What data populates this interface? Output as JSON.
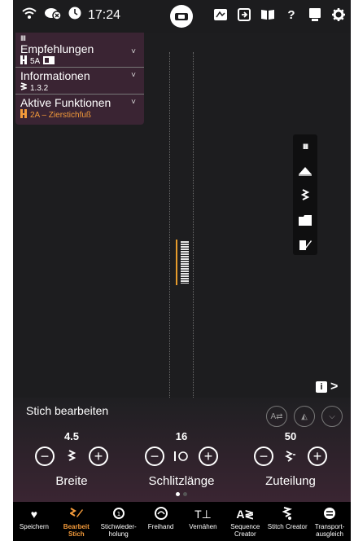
{
  "status": {
    "time": "17:24",
    "icons_left": [
      "wifi-icon",
      "cloud-off-icon",
      "clock-icon"
    ],
    "icons_right": [
      "embroidery-icon",
      "exit-icon",
      "book-icon",
      "help-icon",
      "window-icon",
      "gear-icon"
    ]
  },
  "info_panel": {
    "bars": "IIII",
    "recommendations": {
      "title": "Empfehlungen",
      "value": "5A"
    },
    "information": {
      "title": "Informationen",
      "value": "1.3.2"
    },
    "active_functions": {
      "title": "Aktive Funktionen",
      "value": "2A – Zierstichfuß"
    }
  },
  "right_toolbar": [
    "bars-icon",
    "presser-foot-icon",
    "stitch-icon",
    "folder-icon",
    "edit-icon"
  ],
  "edit_panel": {
    "title": "Stich bearbeiten",
    "controls": [
      {
        "label": "Breite",
        "value": "4.5",
        "icon": "stitch-width-icon"
      },
      {
        "label": "Schlitzlänge",
        "value": "16",
        "icon": "buttonhole-length-icon"
      },
      {
        "label": "Zuteilung",
        "value": "50",
        "icon": "stitch-density-icon"
      }
    ],
    "page": 1,
    "page_count": 2
  },
  "nav": [
    {
      "label": "Speichern",
      "icon": "heart-icon",
      "active": false
    },
    {
      "label": "Bearbeit Stich",
      "icon": "edit-stitch-icon",
      "active": true
    },
    {
      "label": "Stichwieder-holung",
      "icon": "repeat-icon",
      "active": false
    },
    {
      "label": "Freihand",
      "icon": "freehand-icon",
      "active": false
    },
    {
      "label": "Vernähen",
      "icon": "tie-off-icon",
      "active": false
    },
    {
      "label": "Sequence Creator",
      "icon": "sequence-icon",
      "active": false
    },
    {
      "label": "Stitch Creator",
      "icon": "stitch-creator-icon",
      "active": false
    },
    {
      "label": "Transport-ausgleich",
      "icon": "balance-icon",
      "active": false
    }
  ],
  "colors": {
    "accent": "#f39a3a",
    "panel": "#3a2433",
    "background": "#1d1d1f"
  }
}
